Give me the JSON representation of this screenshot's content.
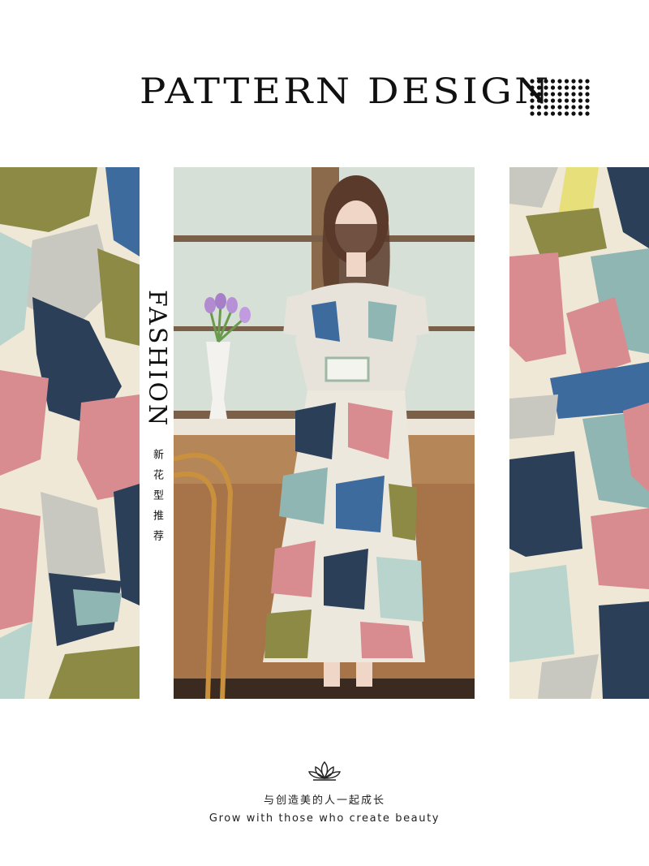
{
  "header": {
    "title": "PATTERN DESIGN"
  },
  "side_label": {
    "word": "FASHION",
    "chinese": "新花型推荐"
  },
  "footer": {
    "slogan_cn": "与创造美的人一起成长",
    "slogan_en": "Grow with those who create beauty"
  },
  "icons": {
    "dots": "dot-grid-icon",
    "lotus": "lotus-icon"
  },
  "colors": {
    "navy": "#2b3f58",
    "olive": "#8c8a45",
    "blue": "#3d6b9e",
    "pink": "#d98c8f",
    "teal": "#8fb6b2",
    "cream": "#efe8d7",
    "mint": "#b9d3cd",
    "gray": "#c9c8c0"
  }
}
